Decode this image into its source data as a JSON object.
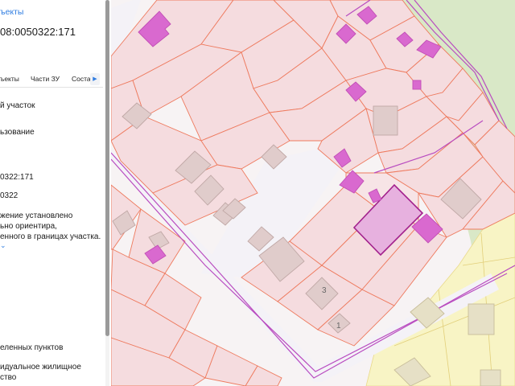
{
  "panel": {
    "objects_link": "ъекты",
    "cadastral_number": "08:0050322:171",
    "tabs": [
      {
        "label": "ъекты"
      },
      {
        "label": "Части ЗУ"
      },
      {
        "label": "Соста"
      }
    ],
    "rows": [
      {
        "text": "й участок"
      },
      {
        "text": "ьзование"
      },
      {
        "text": "0322:171"
      },
      {
        "text": "0322"
      },
      {
        "text": "жение установлено"
      },
      {
        "text": "ьно ориентира,"
      },
      {
        "text": "енного в границах участка."
      },
      {
        "text": "еленных пунктов"
      },
      {
        "text": "идуальное жилищное"
      },
      {
        "text": "ство"
      }
    ]
  },
  "map": {
    "house_labels": [
      "3",
      "1"
    ]
  },
  "colors": {
    "parcel_fill": "#f5dcdf",
    "parcel_stroke": "#ee7a5e",
    "selected_parcel": "#e7b1df",
    "building_magenta": "#d969cf",
    "forest_green": "#d9e8c7",
    "yellow_zone": "#f8f4c5",
    "link_blue": "#2f7de1"
  }
}
